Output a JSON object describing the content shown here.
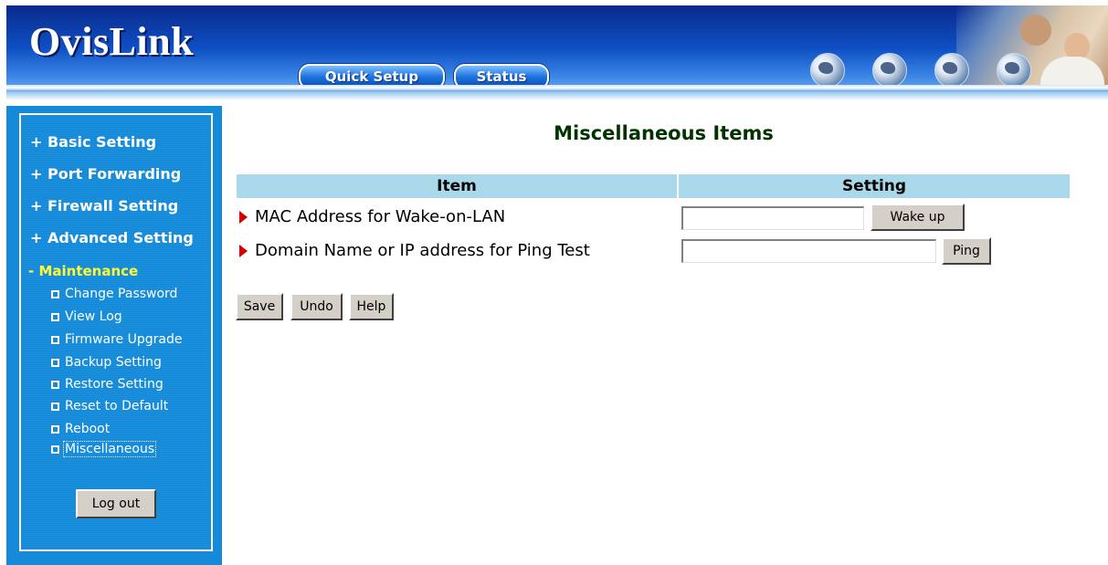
{
  "header": {
    "logo": "OvisLink",
    "quick_setup": "Quick Setup",
    "status": "Status"
  },
  "sidebar": {
    "items": [
      {
        "label": "+ Basic Setting"
      },
      {
        "label": "+ Port Forwarding"
      },
      {
        "label": "+ Firewall Setting"
      },
      {
        "label": "+ Advanced Setting"
      },
      {
        "label": "- Maintenance"
      }
    ],
    "maintenance_items": [
      {
        "label": "Change Password"
      },
      {
        "label": "View Log"
      },
      {
        "label": "Firmware Upgrade"
      },
      {
        "label": "Backup Setting"
      },
      {
        "label": "Restore Setting"
      },
      {
        "label": "Reset to Default"
      },
      {
        "label": "Reboot"
      },
      {
        "label": "Miscellaneous"
      }
    ],
    "logout": "Log out"
  },
  "main": {
    "title": "Miscellaneous Items",
    "table": {
      "headers": [
        "Item",
        "Setting"
      ],
      "rows": [
        {
          "label": "MAC Address for Wake-on-LAN",
          "value": "",
          "button": "Wake up"
        },
        {
          "label": "Domain Name or IP address for Ping Test",
          "value": "",
          "button": "Ping"
        }
      ]
    },
    "buttons": {
      "save": "Save",
      "undo": "Undo",
      "help": "Help"
    }
  },
  "colors": {
    "banner": "#0e4fc4",
    "sidebar": "#158ad8",
    "active_menu": "#ffff33",
    "table_header": "#a9d8eb",
    "title": "#003300",
    "bullet_arrow": "#cc0000"
  }
}
